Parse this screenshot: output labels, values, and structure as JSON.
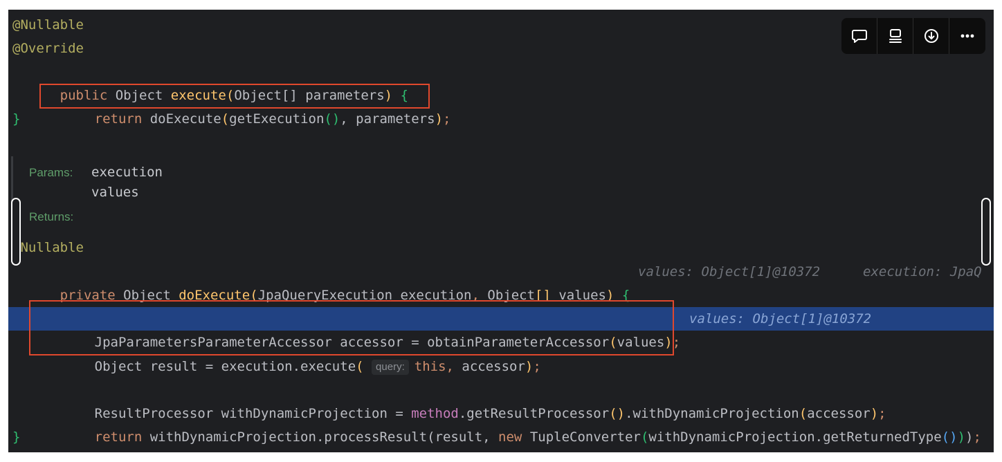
{
  "toolbar": {
    "icons": [
      "comment-icon",
      "text-layout-icon",
      "download-icon",
      "more-icon"
    ]
  },
  "code": {
    "l1": "@Nullable",
    "l2": "@Override",
    "l3": {
      "kw": "public",
      "rest1": " Object ",
      "fn": "execute",
      "p1": "(",
      "rest2": "Object[] parameters",
      "p2": ")",
      "sp": " ",
      "brace": "{"
    },
    "l4": {
      "kw": "return",
      "fn": " doExecute",
      "p1": "(",
      "call": "getExecution",
      "p2": "()",
      "rest": ", parameters",
      "p3": ")",
      "semi": ";"
    },
    "l5": "}",
    "doc": {
      "params_label": "Params:",
      "param1": "execution",
      "param2": "values",
      "returns_label": "Returns:"
    },
    "l6": "@Nullable",
    "l7": {
      "kw": "private",
      "rest1": " Object ",
      "fn": "doExecute",
      "p1": "(",
      "rest2": "JpaQueryExecution execution",
      "comma": ",",
      "rest3": " Object",
      "br": "[]",
      "rest4": " values",
      "p2": ")",
      "sp": " ",
      "brace": "{",
      "hint1": "values: Object[1]@10372",
      "hint2": "execution: JpaQ"
    },
    "l8": {
      "type": "JpaParametersParameterAccessor",
      "rest": " accessor = obtainParameterAccessor",
      "p1": "(",
      "arg": "values",
      "p2": ")",
      "semi": ";",
      "hint": "values: Object[1]@10372"
    },
    "l9": {
      "start": "Object result = execution.execute",
      "p1": "(",
      "param_hint": "query:",
      "kw": "this",
      "comma": ",",
      "rest": " accessor",
      "p2": ")",
      "semi": ";"
    },
    "l10": {
      "start": "ResultProcessor withDynamicProjection = ",
      "field": "method",
      "rest1": ".getResultProcessor",
      "p1": "()",
      "rest2": ".withDynamicProjection",
      "p2": "(",
      "arg": "accessor",
      "p3": ")",
      "semi": ";"
    },
    "l11": {
      "kw": "return",
      "rest1": " withDynamicProjection.processResult(result, ",
      "kw2": "new",
      "rest2": " TupleConverter",
      "p1": "(",
      "rest3": "withDynamicProjection.getReturnedType",
      "p2": "()",
      "p3": ")",
      "p4": ")",
      "semi": ";"
    },
    "l12": "}"
  }
}
